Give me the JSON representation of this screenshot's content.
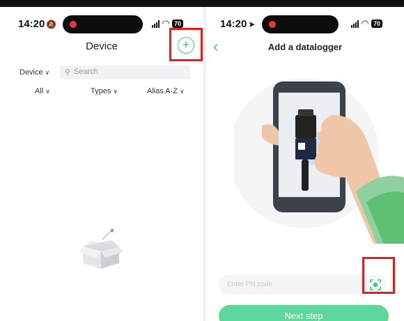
{
  "left_screen": {
    "status": {
      "time": "14:20",
      "time_icon": "bell-slash-icon",
      "battery": "70"
    },
    "title": "Device",
    "add_icon": "plus-circle-icon",
    "filter": {
      "device_dropdown": "Device",
      "search_placeholder": "Search"
    },
    "sort": {
      "all": "All",
      "types": "Types",
      "alias": "Alias A-Z"
    },
    "empty_state_icon": "empty-box-icon"
  },
  "right_screen": {
    "status": {
      "time": "14:20",
      "time_icon": "location-arrow-icon",
      "battery": "70"
    },
    "title": "Add a datalogger",
    "illustration": "hand-scanning-datalogger-illustration",
    "pn_placeholder": "Enter PN code",
    "scan_icon": "scan-code-icon",
    "next_button": "Next step"
  },
  "colors": {
    "accent": "#3dc48a",
    "button": "#5fd69b",
    "highlight": "#e81c1c"
  }
}
